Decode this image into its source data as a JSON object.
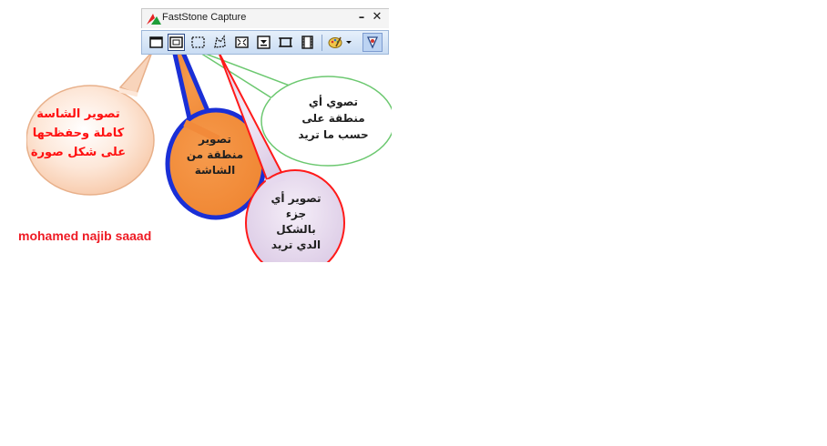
{
  "window": {
    "title": "FastStone Capture",
    "minimize_glyph": "–",
    "close_glyph": "✕"
  },
  "toolbar": {
    "buttons": [
      {
        "name": "capture-active-window-icon"
      },
      {
        "name": "capture-window-object-icon",
        "selected": true
      },
      {
        "name": "capture-rectangular-region-icon"
      },
      {
        "name": "capture-freehand-region-icon"
      },
      {
        "name": "capture-full-screen-icon"
      },
      {
        "name": "capture-scrolling-window-icon"
      },
      {
        "name": "capture-fixed-region-icon"
      },
      {
        "name": "screen-recorder-icon"
      },
      {
        "name": "output-options-icon"
      },
      {
        "name": "settings-icon"
      }
    ]
  },
  "callouts": {
    "full_screen": "تصوير الشاسة\nكاملة وحفظحها\nعلى شكل صورة",
    "screen_region": "تصوير\nمنطقة من\nالشاشة",
    "any_area": "تصوي أي\nمنطقة على\nحسب ما تريد",
    "any_part": "تصوير أي\nجزء\nبالشكل\nالدي تريد"
  },
  "author": "mohamed najib saaad",
  "colors": {
    "callout_fill": "#fde9dc",
    "orange_fill": "#f28a3a",
    "blue_stroke": "#1a2fd6",
    "red_text": "#ff1010",
    "purple_fill": "#e6d9ee"
  }
}
